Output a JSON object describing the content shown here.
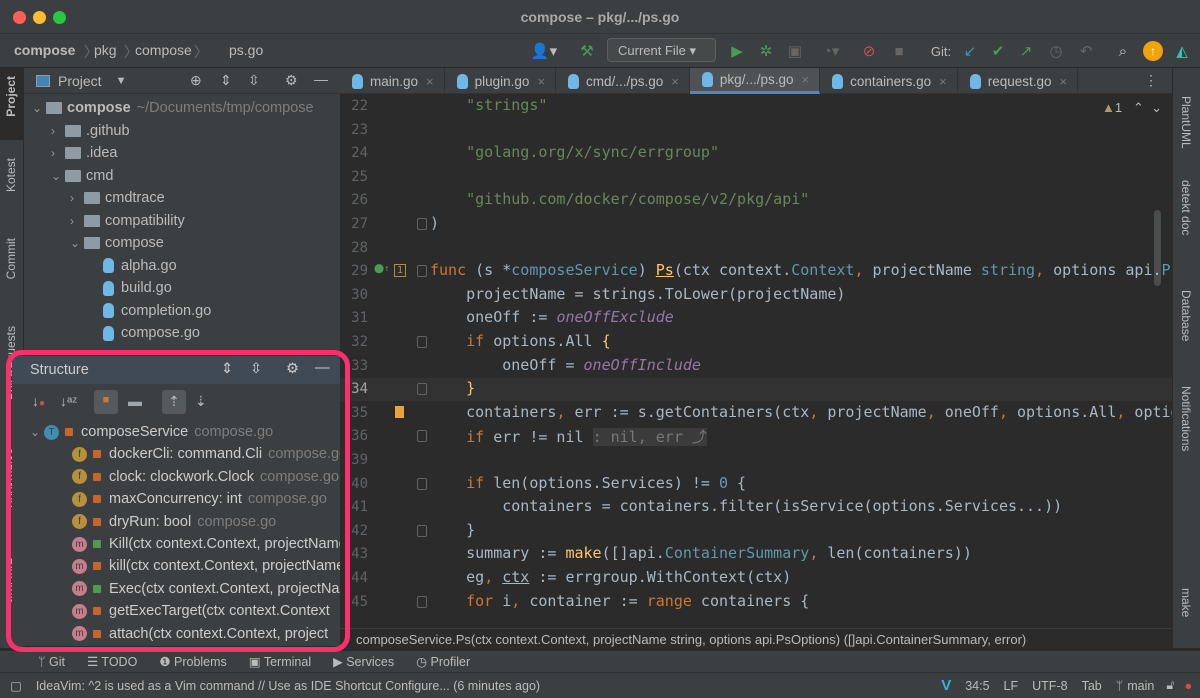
{
  "window": {
    "title": "compose – pkg/.../ps.go"
  },
  "navbar": {
    "breadcrumb": [
      "compose",
      "pkg",
      "compose",
      "ps.go"
    ],
    "run_config": "Current File",
    "git_label": "Git:"
  },
  "colors": {
    "accent": "#4a88c7",
    "highlight": "#ff2f6d",
    "run": "#499c54"
  },
  "left_strip": [
    "Project",
    "Kotest",
    "Commit",
    "Pull Requests",
    "Bookmarks",
    "Structure"
  ],
  "right_strip": [
    "PlantUML",
    "detekt doc",
    "Database",
    "Notifications",
    "make"
  ],
  "project": {
    "title": "Project",
    "root": {
      "name": "compose",
      "path": "~/Documents/tmp/compose"
    },
    "items": [
      {
        "name": ".github",
        "type": "folder",
        "depth": 1,
        "state": "collapsed"
      },
      {
        "name": ".idea",
        "type": "folder",
        "depth": 1,
        "state": "collapsed"
      },
      {
        "name": "cmd",
        "type": "folder",
        "depth": 1,
        "state": "expanded"
      },
      {
        "name": "cmdtrace",
        "type": "folder",
        "depth": 2,
        "state": "collapsed"
      },
      {
        "name": "compatibility",
        "type": "folder",
        "depth": 2,
        "state": "collapsed"
      },
      {
        "name": "compose",
        "type": "folder",
        "depth": 2,
        "state": "expanded"
      },
      {
        "name": "alpha.go",
        "type": "go",
        "depth": 3
      },
      {
        "name": "build.go",
        "type": "go",
        "depth": 3
      },
      {
        "name": "completion.go",
        "type": "go",
        "depth": 3
      },
      {
        "name": "compose.go",
        "type": "go",
        "depth": 3
      }
    ]
  },
  "structure": {
    "title": "Structure",
    "root": {
      "badge": "T",
      "name": "composeService",
      "file": "compose.go"
    },
    "items": [
      {
        "badge": "f",
        "name": "dockerCli: command.Cli",
        "file": "compose.go",
        "access": "private"
      },
      {
        "badge": "f",
        "name": "clock: clockwork.Clock",
        "file": "compose.go",
        "access": "private"
      },
      {
        "badge": "f",
        "name": "maxConcurrency: int",
        "file": "compose.go",
        "access": "private"
      },
      {
        "badge": "f",
        "name": "dryRun: bool",
        "file": "compose.go",
        "access": "private"
      },
      {
        "badge": "m",
        "name": "Kill(ctx context.Context, projectName",
        "file": "",
        "access": "public"
      },
      {
        "badge": "m",
        "name": "kill(ctx context.Context, projectName",
        "file": "",
        "access": "private"
      },
      {
        "badge": "m",
        "name": "Exec(ctx context.Context, projectName",
        "file": "",
        "access": "public"
      },
      {
        "badge": "m",
        "name": "getExecTarget(ctx context.Context",
        "file": "",
        "access": "private"
      },
      {
        "badge": "m",
        "name": "attach(ctx context.Context, project",
        "file": "",
        "access": "private"
      }
    ]
  },
  "tabs": [
    {
      "label": "main.go",
      "active": false
    },
    {
      "label": "plugin.go",
      "active": false
    },
    {
      "label": "cmd/.../ps.go",
      "active": false
    },
    {
      "label": "pkg/.../ps.go",
      "active": true
    },
    {
      "label": "containers.go",
      "active": false
    },
    {
      "label": "request.go",
      "active": false
    }
  ],
  "editor": {
    "warnings": "1",
    "current_line": "34",
    "lines": [
      {
        "n": "22",
        "tokens": [
          [
            "    ",
            ""
          ],
          [
            "\"strings\"",
            "s"
          ]
        ]
      },
      {
        "n": "23",
        "tokens": []
      },
      {
        "n": "24",
        "tokens": [
          [
            "    ",
            ""
          ],
          [
            "\"golang.org/x/sync/errgroup\"",
            "s"
          ]
        ]
      },
      {
        "n": "25",
        "tokens": []
      },
      {
        "n": "26",
        "tokens": [
          [
            "    ",
            ""
          ],
          [
            "\"github.com/docker/compose/v2/pkg/api\"",
            "s"
          ]
        ]
      },
      {
        "n": "27",
        "tokens": [
          [
            ")",
            ""
          ]
        ]
      },
      {
        "n": "28",
        "tokens": []
      },
      {
        "n": "29",
        "tokens": [
          [
            "func",
            "k"
          ],
          [
            " (s *",
            ""
          ],
          [
            "composeService",
            "ty"
          ],
          [
            ") ",
            ""
          ],
          [
            "Ps",
            "f u"
          ],
          [
            "(ctx context.",
            ""
          ],
          [
            "Context",
            "ty"
          ],
          [
            ",",
            "c"
          ],
          [
            " projectName ",
            ""
          ],
          [
            "string",
            "ty"
          ],
          [
            ",",
            "c"
          ],
          [
            " options api.",
            ""
          ],
          [
            "PsOptions",
            "ty"
          ]
        ]
      },
      {
        "n": "30",
        "tokens": [
          [
            "    projectName = strings.ToLower(projectName)",
            ""
          ]
        ]
      },
      {
        "n": "31",
        "tokens": [
          [
            "    oneOff := ",
            ""
          ],
          [
            "oneOffExclude",
            "p"
          ]
        ]
      },
      {
        "n": "32",
        "tokens": [
          [
            "    ",
            ""
          ],
          [
            "if",
            "k"
          ],
          [
            " options.All ",
            ""
          ],
          [
            "{",
            "f"
          ]
        ]
      },
      {
        "n": "33",
        "tokens": [
          [
            "        oneOff = ",
            ""
          ],
          [
            "oneOffInclude",
            "p"
          ]
        ]
      },
      {
        "n": "34",
        "tokens": [
          [
            "    ",
            ""
          ],
          [
            "}",
            "f"
          ]
        ]
      },
      {
        "n": "35",
        "tokens": [
          [
            "    containers",
            ""
          ],
          [
            ",",
            "c"
          ],
          [
            " err := s.getContainers(ctx",
            ""
          ],
          [
            ",",
            "c"
          ],
          [
            " projectName",
            ""
          ],
          [
            ",",
            "c"
          ],
          [
            " oneOff",
            ""
          ],
          [
            ",",
            "c"
          ],
          [
            " options.All",
            ""
          ],
          [
            ",",
            "c"
          ],
          [
            " options.Services...)",
            ""
          ]
        ]
      },
      {
        "n": "36",
        "tokens": [
          [
            "    ",
            ""
          ],
          [
            "if",
            "k"
          ],
          [
            " err != nil ",
            ""
          ],
          [
            ": nil, err ⤴",
            "h"
          ]
        ]
      },
      {
        "n": "39",
        "tokens": []
      },
      {
        "n": "40",
        "tokens": [
          [
            "    ",
            ""
          ],
          [
            "if",
            "k"
          ],
          [
            " len(options.Services) != ",
            ""
          ],
          [
            "0",
            "t"
          ],
          [
            " {",
            ""
          ]
        ]
      },
      {
        "n": "41",
        "tokens": [
          [
            "        containers = containers.filter(isService(options.Services...))",
            ""
          ]
        ]
      },
      {
        "n": "42",
        "tokens": [
          [
            "    }",
            ""
          ]
        ]
      },
      {
        "n": "43",
        "tokens": [
          [
            "    summary := ",
            ""
          ],
          [
            "make",
            "f"
          ],
          [
            "([]api.",
            ""
          ],
          [
            "ContainerSummary",
            "ty"
          ],
          [
            ",",
            "c"
          ],
          [
            " len(containers))",
            ""
          ]
        ]
      },
      {
        "n": "44",
        "tokens": [
          [
            "    eg",
            ""
          ],
          [
            ",",
            "c"
          ],
          [
            " ",
            ""
          ],
          [
            "ctx",
            "u"
          ],
          [
            " := errgroup.WithContext(ctx)",
            ""
          ]
        ]
      },
      {
        "n": "45",
        "tokens": [
          [
            "    ",
            ""
          ],
          [
            "for",
            "k"
          ],
          [
            " i",
            ""
          ],
          [
            ",",
            "c"
          ],
          [
            " container := ",
            ""
          ],
          [
            "range",
            "k"
          ],
          [
            " containers {",
            ""
          ]
        ]
      }
    ]
  },
  "code_breadcrumb": "composeService.Ps(ctx context.Context, projectName string, options api.PsOptions) ([]api.ContainerSummary, error)",
  "tool_windows": [
    "Git",
    "TODO",
    "Problems",
    "Terminal",
    "Services",
    "Profiler"
  ],
  "status": {
    "message": "IdeaVim: ^2 is used as a Vim command // Use as IDE Shortcut  Configure... (6 minutes ago)",
    "position": "34:5",
    "line_sep": "LF",
    "encoding": "UTF-8",
    "indent": "Tab",
    "branch": "main"
  }
}
